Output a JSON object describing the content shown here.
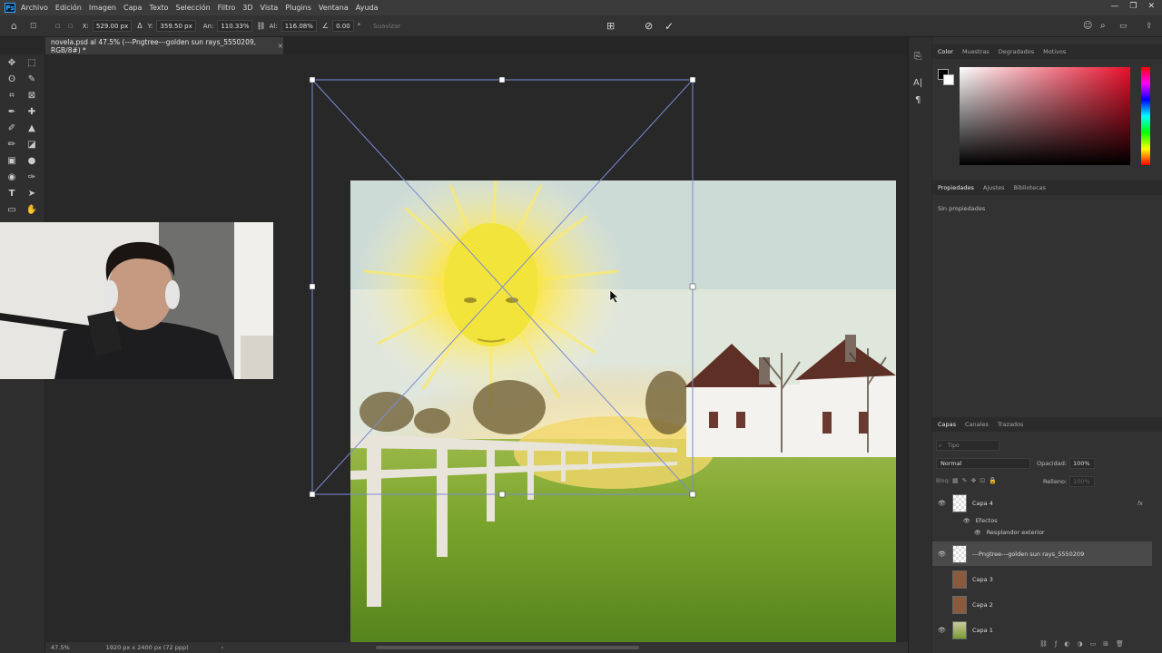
{
  "app": {
    "menu": [
      "Archivo",
      "Edición",
      "Imagen",
      "Capa",
      "Texto",
      "Selección",
      "Filtro",
      "3D",
      "Vista",
      "Plugins",
      "Ventana",
      "Ayuda"
    ]
  },
  "options": {
    "x_label": "X:",
    "x_value": "529.00 px",
    "y_label": "Y:",
    "y_value": "359.50 px",
    "w_label": "An:",
    "w_value": "110.33%",
    "h_label": "Al:",
    "h_value": "116.08%",
    "angle_value": "0.00",
    "angle_unit": "°",
    "interp_label": "Suavizar"
  },
  "document": {
    "tab_title": "novela.psd al 47.5% (---Pngtree---golden sun rays_5550209, RGB/8#) *",
    "tab_close": "×"
  },
  "status": {
    "zoom": "47.5%",
    "doc_info": "1920 px x 2400 px (72 ppp)",
    "arrow": "›"
  },
  "color_panel": {
    "tabs": [
      "Color",
      "Muestras",
      "Degradados",
      "Motivos"
    ]
  },
  "properties_panel": {
    "tabs": [
      "Propiedades",
      "Ajustes",
      "Bibliotecas"
    ],
    "empty_text": "Sin propiedades"
  },
  "layers_panel": {
    "tabs": [
      "Capas",
      "Canales",
      "Trazados"
    ],
    "search_placeholder": "Tipo",
    "blend_mode": "Normal",
    "opacity_label": "Opacidad:",
    "opacity_value": "100%",
    "lock_label": "Bloq:",
    "fill_label": "Relleno:",
    "fill_value": "100%",
    "fx_label": "fx",
    "effects_label": "Efectos",
    "effect_name": "Resplandor exterior",
    "layers": [
      {
        "name": "Capa 4",
        "visible": true
      },
      {
        "name": "---Pngtree---golden sun rays_5550209",
        "visible": true
      },
      {
        "name": "Capa 3",
        "visible": false
      },
      {
        "name": "Capa 2",
        "visible": false
      },
      {
        "name": "Capa 1",
        "visible": true
      }
    ]
  },
  "colors": {
    "accent": "#31a8ff",
    "transform_line": "#7a8bd6"
  }
}
